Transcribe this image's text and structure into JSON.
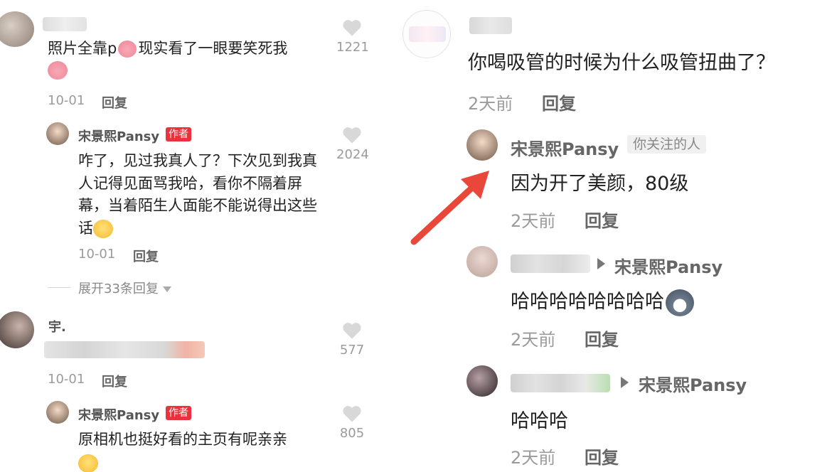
{
  "left": {
    "comment1": {
      "text": "照片全靠p",
      "text_tail": "现实看了一眼要笑死我",
      "emoji_inline": "pig-emoji",
      "emoji_end": "pig-emoji",
      "date": "10-01",
      "reply": "回复",
      "likes": "1221"
    },
    "reply1": {
      "name": "宋景熙Pansy",
      "tag": "作者",
      "text": "咋了，见过我真人了？下次见到我真人记得见面骂我哈，看你不隔着屏幕，当着陌生人面能不能说得出这些话",
      "emoji_end": "dizzy-face-emoji",
      "date": "10-01",
      "reply": "回复",
      "likes": "2024"
    },
    "expand": "展开33条回复",
    "comment2": {
      "name": "宇.",
      "date": "10-01",
      "reply": "回复",
      "likes": "577"
    },
    "reply2": {
      "name": "宋景熙Pansy",
      "tag": "作者",
      "text": "原相机也挺好看的主页有呢亲亲",
      "emoji_end": "grin-emoji",
      "likes": "805"
    }
  },
  "right": {
    "comment1": {
      "text": "你喝吸管的时候为什么吸管扭曲了？",
      "time": "2天前",
      "reply": "回复"
    },
    "reply1": {
      "name": "宋景熙Pansy",
      "tag": "你关注的人",
      "text": "因为开了美颜，80级",
      "time": "2天前",
      "reply": "回复"
    },
    "reply2": {
      "target": "宋景熙Pansy",
      "text": "哈哈哈哈哈哈哈哈",
      "emoji_end": "husky-emoji",
      "time": "2天前",
      "reply": "回复"
    },
    "reply3": {
      "target": "宋景熙Pansy",
      "text": "哈哈哈",
      "time": "2天前",
      "reply": "回复"
    }
  },
  "colors": {
    "author_tag": "#e8323c",
    "arrow": "#e8473a",
    "muted": "#9b9b9b"
  }
}
